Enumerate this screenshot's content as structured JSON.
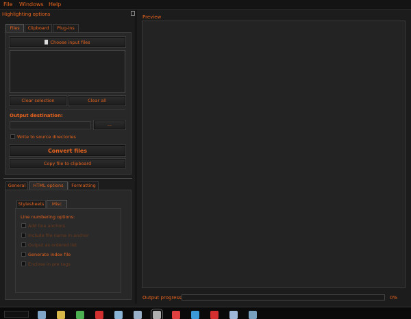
{
  "menu": [
    "File",
    "Windows",
    "Help"
  ],
  "left_title": "Highlighting options",
  "tabs_top": [
    "Files",
    "Clipboard",
    "Plug-ins"
  ],
  "files": {
    "choose_button": "Choose input files",
    "clear_selection": "Clear selection",
    "clear_all": "Clear all",
    "output_destination_label": "Output destination:",
    "browse_button": "...",
    "write_to_source": "Write to source directories",
    "convert_button": "Convert files",
    "copy_button": "Copy file to clipboard"
  },
  "tabs_bottom": [
    "General",
    "HTML options",
    "Formatting"
  ],
  "tabs_inner": [
    "Stylesheets",
    "Misc"
  ],
  "misc": {
    "group_label": "Line numbering options:",
    "options": [
      {
        "label": "Add line anchors",
        "enabled": false
      },
      {
        "label": "Include file name in anchor",
        "enabled": false
      },
      {
        "label": "Output as ordered list",
        "enabled": false
      },
      {
        "label": "Generate index file",
        "enabled": true
      },
      {
        "label": "Enclose in pre tags",
        "enabled": false
      }
    ]
  },
  "preview": {
    "label": "Preview"
  },
  "progress": {
    "label": "Output progress:",
    "value": 0,
    "percent_text": "0%"
  },
  "taskbar_icons": [
    {
      "name": "file-manager-icon",
      "color": "#7fa6c9"
    },
    {
      "name": "media-player-icon",
      "color": "#d9b84a"
    },
    {
      "name": "chrome-icon",
      "color": "#4caf50"
    },
    {
      "name": "opera-icon",
      "color": "#d32f2f"
    },
    {
      "name": "notes-icon",
      "color": "#8ab4d6"
    },
    {
      "name": "text-editor-icon",
      "color": "#9ab0c8"
    },
    {
      "name": "highlighter-app-icon",
      "color": "#b0b0b0"
    },
    {
      "name": "mail-icon",
      "color": "#e04040"
    },
    {
      "name": "bird-icon",
      "color": "#3a9ad9"
    },
    {
      "name": "opera-icon-2",
      "color": "#d32f2f"
    },
    {
      "name": "document-icon",
      "color": "#9fb7d8"
    },
    {
      "name": "image-viewer-icon",
      "color": "#7aa0c0"
    }
  ]
}
